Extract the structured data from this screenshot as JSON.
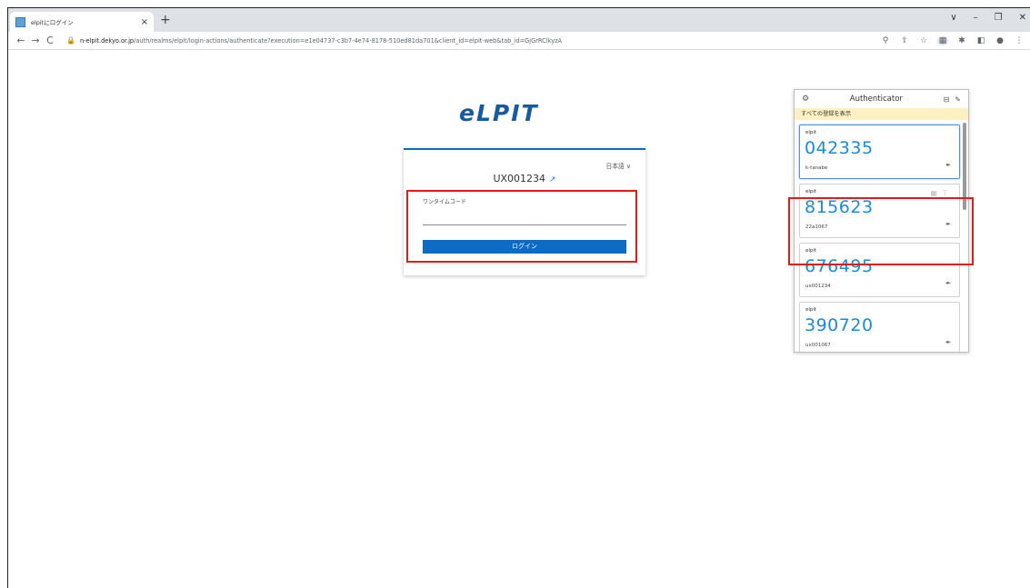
{
  "browser": {
    "tab_title": "elpitにログイン",
    "tab_close": "×",
    "new_tab": "+",
    "window_controls": [
      "∨",
      "–",
      "❐",
      "✕"
    ],
    "url_host": "n-elpit.dekyo.or.jp",
    "url_path": "/auth/realms/elpit/login-actions/authenticate?execution=e1e04737-c3b7-4e74-8178-510ed81da701&client_id=elpit-web&tab_id=GjGrRClkyzA"
  },
  "login": {
    "logo_text": "eLPIT",
    "language": "日本語 ∨",
    "username": "UX001234",
    "otp_label": "ワンタイムコード",
    "otp_value": "",
    "login_button": "ログイン"
  },
  "authenticator": {
    "title": "Authenticator",
    "show_all": "すべての登録を表示",
    "entries": [
      {
        "issuer": "elpit",
        "code": "042335",
        "account": "k-tanabe"
      },
      {
        "issuer": "elpit",
        "code": "815623",
        "account": "22a1067"
      },
      {
        "issuer": "elpit",
        "code": "676495",
        "account": "ux001234"
      },
      {
        "issuer": "elpit",
        "code": "390720",
        "account": "ux001067"
      }
    ]
  },
  "colors": {
    "accent": "#0d6bc3",
    "code_blue": "#1c8bd2",
    "highlight_red": "#e41b1b",
    "banner_yellow": "#fdf1c4"
  }
}
